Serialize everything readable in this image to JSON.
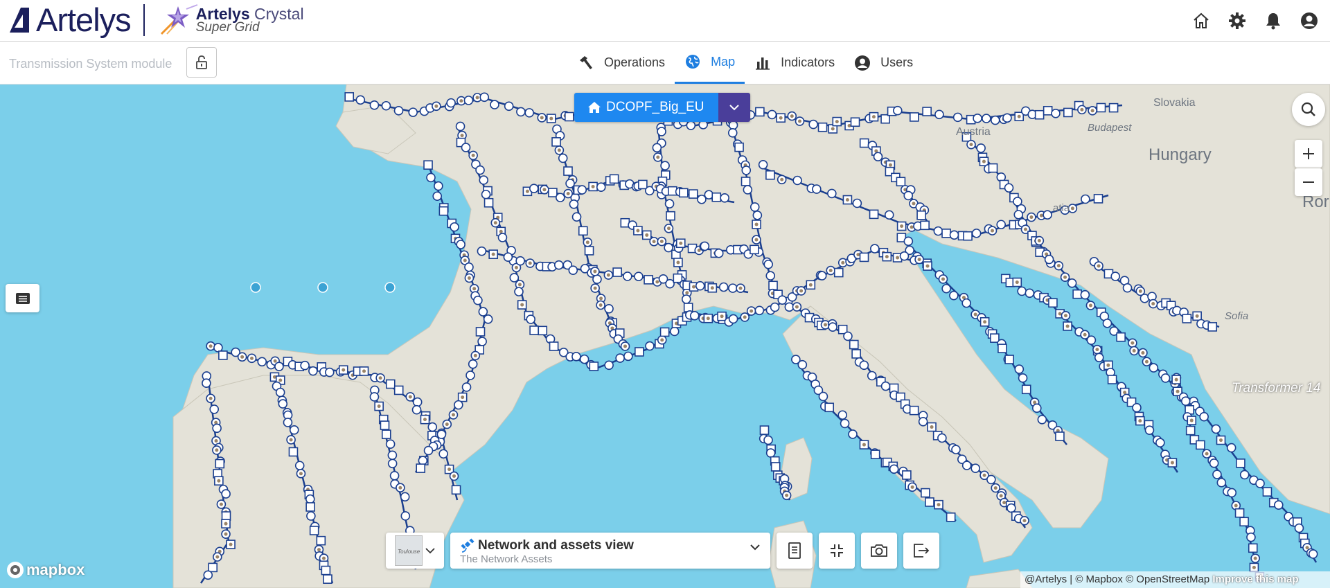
{
  "brand": {
    "company": "Artelys",
    "product_top_bold": "Artelys",
    "product_top_light": "Crystal",
    "product_sub": "Super Grid"
  },
  "header_icons": [
    "home-icon",
    "gear-icon",
    "bell-icon",
    "user-icon"
  ],
  "subheader": {
    "module_title": "Transmission System module",
    "tabs": [
      {
        "label": "Operations",
        "icon": "hammer-icon",
        "active": false
      },
      {
        "label": "Map",
        "icon": "globe-icon",
        "active": true
      },
      {
        "label": "Indicators",
        "icon": "bar-chart-icon",
        "active": false
      },
      {
        "label": "Users",
        "icon": "user-icon",
        "active": false
      }
    ]
  },
  "map": {
    "scenario": "DCOPF_Big_EU",
    "labels": {
      "slovakia": "Slovakia",
      "budapest": "Budapest",
      "hungary": "Hungary",
      "romania_partial": "Ror",
      "austria_partial": "Austria",
      "croatia_partial": "atia",
      "sofia": "Sofia",
      "transformer": "Transformer 14"
    },
    "view": {
      "title": "Network and assets view",
      "subtitle": "The Network Assets",
      "thumbnail_label": "Toulouse"
    },
    "mapbox": "mapbox",
    "attribution": {
      "artelys": "@Artelys",
      "mapbox": "© Mapbox © OpenStreetMap",
      "improve": "Improve this map"
    }
  },
  "colors": {
    "accent": "#1e7ee0",
    "scenario_blue": "#1e88f0",
    "scenario_purple": "#4a3e9a",
    "sea": "#7bcfea",
    "land": "#e4e2d8",
    "network_blue": "#1b3f8f"
  }
}
